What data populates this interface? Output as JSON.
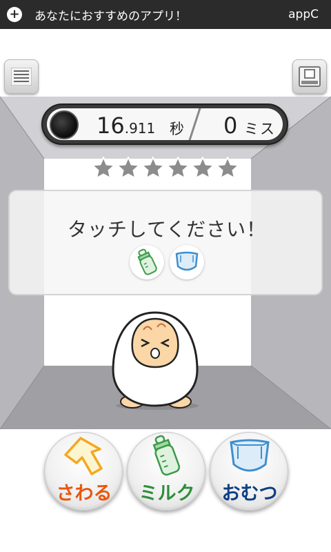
{
  "ad": {
    "text": "あなたにおすすめのアプリ！",
    "brand": "appC",
    "plus_icon": "plus-icon"
  },
  "toolbar": {
    "menu_icon": "menu-icon",
    "camera_icon": "camera-icon"
  },
  "timer": {
    "seconds_main": "16",
    "seconds_frac": ".911",
    "seconds_unit": "秒",
    "miss_count": "0",
    "miss_unit": "ミス"
  },
  "stars": {
    "count": 6
  },
  "panel": {
    "instruction": "タッチしてください！",
    "icons": [
      "milk-bottle-icon",
      "diaper-icon"
    ]
  },
  "actions": [
    {
      "label": "さわる",
      "icon": "arrow-up-icon",
      "color": "#e9560a"
    },
    {
      "label": "ミルク",
      "icon": "milk-bottle-icon",
      "color": "#2c8f3a"
    },
    {
      "label": "おむつ",
      "icon": "diaper-icon",
      "color": "#0c3f82"
    }
  ],
  "colors": {
    "ad_bg": "#2b2b2b",
    "room_wall": "#b5b3b8",
    "room_floor": "#9a999e",
    "baby_skin": "#fbd6a7"
  }
}
